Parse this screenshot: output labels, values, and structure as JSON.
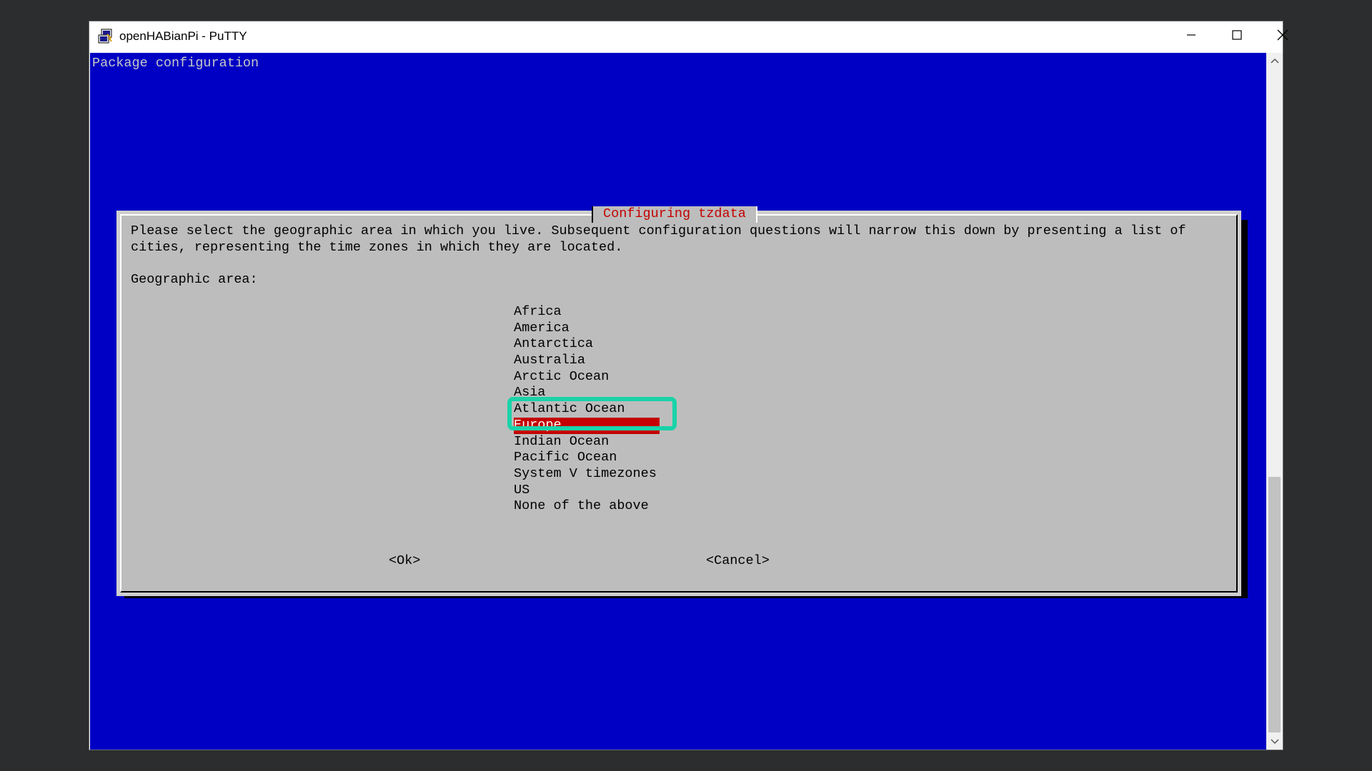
{
  "window": {
    "title": "openHABianPi - PuTTY",
    "icon": "putty-icon",
    "controls": [
      "minimize-icon",
      "maximize-icon",
      "close-icon"
    ]
  },
  "terminal": {
    "header": "Package configuration",
    "background": "#0000c4"
  },
  "dialog": {
    "title": "Configuring tzdata",
    "description_line1": "Please select the geographic area in which you live. Subsequent configuration questions will narrow this down by presenting a list of",
    "description_line2": "cities, representing the time zones in which they are located.",
    "field_label": "Geographic area:",
    "areas": [
      "Africa",
      "America",
      "Antarctica",
      "Australia",
      "Arctic Ocean",
      "Asia",
      "Atlantic Ocean",
      "Europe",
      "Indian Ocean",
      "Pacific Ocean",
      "System V timezones",
      "US",
      "None of the above"
    ],
    "selected_area": "Europe",
    "ok_label": "<Ok>",
    "cancel_label": "<Cancel>"
  },
  "colors": {
    "selection": "#c40000",
    "title_text": "#c40000",
    "highlight_ring": "#1ad3a8",
    "dialog_bg": "#bdbdbd"
  }
}
